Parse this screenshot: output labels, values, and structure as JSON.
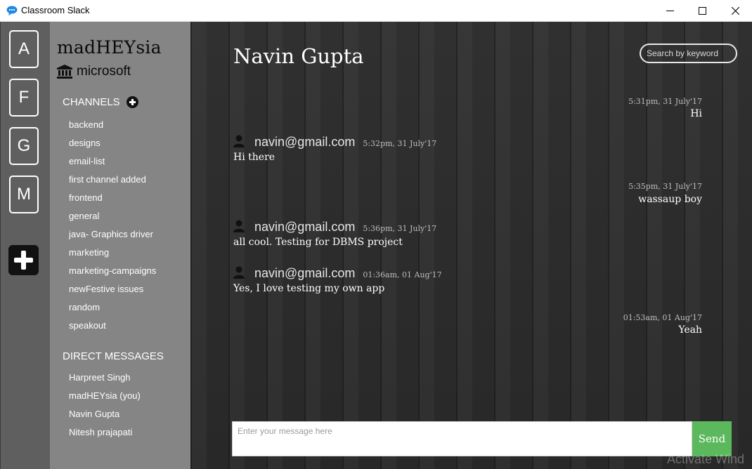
{
  "window": {
    "title": "Classroom Slack"
  },
  "workspaces": [
    "A",
    "F",
    "G",
    "M"
  ],
  "sidebar": {
    "team_name": "madHEYsia",
    "org_name": "microsoft",
    "channels_title": "CHANNELS",
    "channels": [
      "backend",
      "designs",
      "email-list",
      "first channel added",
      "frontend",
      "general",
      "java- Graphics driver",
      "marketing",
      "marketing-campaigns",
      "newFestive issues",
      "random",
      "speakout"
    ],
    "dm_title": "DIRECT MESSAGES",
    "direct_messages": [
      "Harpreet Singh",
      "madHEYsia (you)",
      "Navin Gupta",
      "Nitesh prajapati"
    ]
  },
  "chat": {
    "title": "Navin Gupta",
    "search_placeholder": "Search by keyword",
    "messages": [
      {
        "side": "right",
        "time": "5:31pm, 31 July'17",
        "text": "Hi"
      },
      {
        "side": "left",
        "sender": "navin@gmail.com",
        "time": "5:32pm, 31 July'17",
        "text": "Hi there"
      },
      {
        "side": "right",
        "time": "5:35pm, 31 July'17",
        "text": "wassaup boy"
      },
      {
        "side": "left",
        "sender": "navin@gmail.com",
        "time": "5:36pm, 31 July'17",
        "text": "all cool. Testing for DBMS project"
      },
      {
        "side": "left",
        "sender": "navin@gmail.com",
        "time": "01:36am, 01 Aug'17",
        "text": "Yes, I love testing my own app"
      },
      {
        "side": "right",
        "time": "01:53am, 01 Aug'17",
        "text": "Yeah"
      }
    ],
    "composer_placeholder": "Enter your message here",
    "send_label": "Send"
  },
  "os": {
    "watermark": "Activate Wind"
  }
}
